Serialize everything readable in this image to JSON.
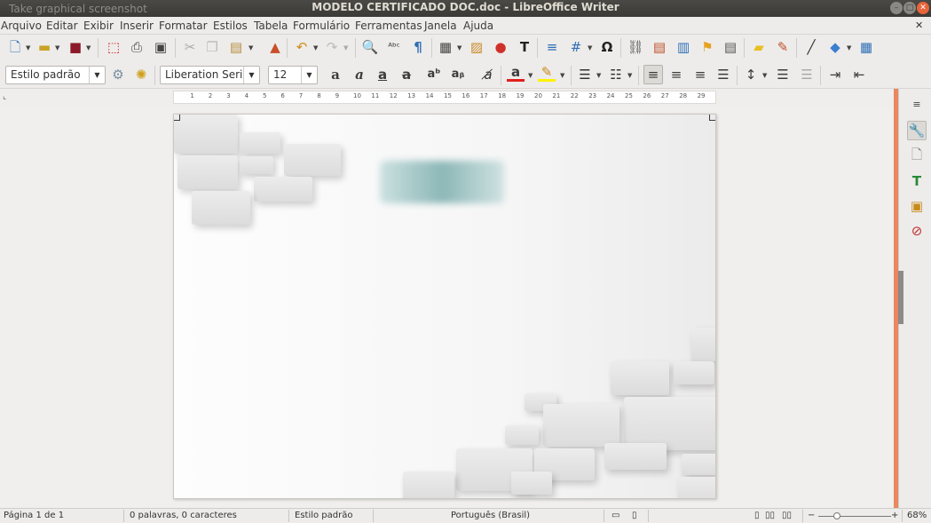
{
  "window": {
    "screenshot_label": "Take graphical screenshot",
    "title": "MODELO CERTIFICADO DOC.doc - LibreOffice Writer"
  },
  "menubar": {
    "items": [
      "Arquivo",
      "Editar",
      "Exibir",
      "Inserir",
      "Formatar",
      "Estilos",
      "Tabela",
      "Formulário",
      "Ferramentas",
      "Janela",
      "Ajuda"
    ]
  },
  "formatting": {
    "paragraph_style": "Estilo padrão",
    "font_name": "Liberation Seri",
    "font_size": "12"
  },
  "ruler": {
    "labels": [
      "1",
      "2",
      "3",
      "4",
      "5",
      "6",
      "7",
      "8",
      "9",
      "10",
      "11",
      "12",
      "13",
      "14",
      "15",
      "16",
      "17",
      "18",
      "19",
      "20",
      "21",
      "22",
      "23",
      "24",
      "25",
      "26",
      "27",
      "28",
      "29"
    ]
  },
  "statusbar": {
    "page": "Página 1 de 1",
    "words": "0 palavras, 0 caracteres",
    "style": "Estilo padrão",
    "language": "Português (Brasil)",
    "zoom": "68%"
  },
  "colors": {
    "accent_orange": "#e9875f",
    "font_color_bar": "#e31e1e",
    "highlight_bar": "#fff200"
  },
  "icons": {
    "toolbar1": [
      "new-document-icon",
      "open-folder-icon",
      "save-icon",
      "export-pdf-icon",
      "print-icon",
      "print-preview-icon",
      "cut-icon",
      "copy-icon",
      "paste-icon",
      "clone-format-icon",
      "undo-icon",
      "redo-icon",
      "find-replace-icon",
      "spellcheck-icon",
      "formatting-marks-icon",
      "insert-table-icon",
      "insert-image-icon",
      "insert-chart-icon",
      "insert-textbox-icon",
      "page-break-icon",
      "insert-field-icon",
      "special-character-icon",
      "hyperlink-icon",
      "footnote-icon",
      "endnote-icon",
      "bookmark-icon",
      "cross-reference-icon",
      "comment-icon",
      "track-changes-icon",
      "line-icon",
      "basic-shapes-icon",
      "show-draw-functions-icon"
    ],
    "toolbar2": [
      "update-style-icon",
      "new-style-icon",
      "bold-icon",
      "italic-icon",
      "underline-icon",
      "strikethrough-icon",
      "superscript-icon",
      "subscript-icon",
      "clear-formatting-icon",
      "font-color-icon",
      "highlight-icon",
      "bullets-icon",
      "numbering-icon",
      "align-left-icon",
      "align-center-icon",
      "align-right-icon",
      "justify-icon",
      "line-spacing-icon",
      "increase-paragraph-spacing-icon",
      "decrease-paragraph-spacing-icon",
      "increase-indent-icon",
      "decrease-indent-icon"
    ],
    "sidebar": [
      "sidebar-menu-icon",
      "properties-icon",
      "page-icon",
      "styles-icon",
      "gallery-icon",
      "navigator-icon"
    ]
  }
}
